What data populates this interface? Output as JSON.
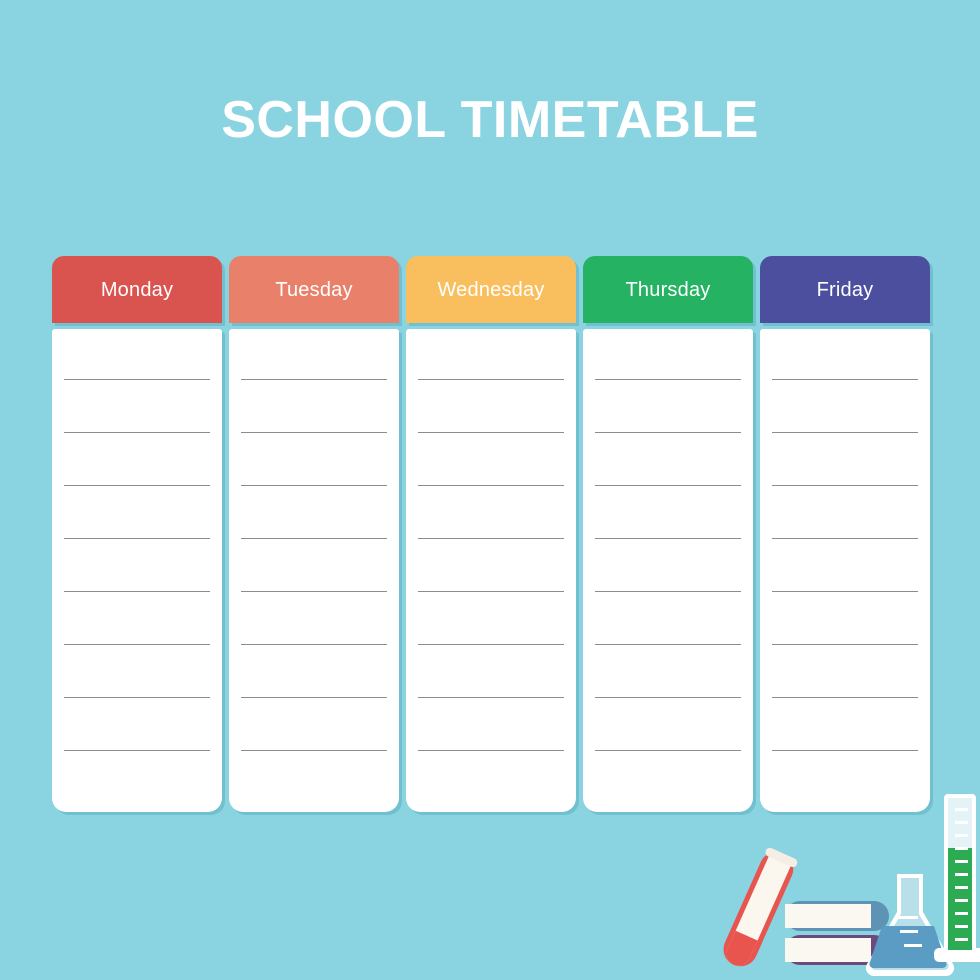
{
  "page": {
    "title": "SCHOOL TIMETABLE",
    "background_color": "#8ad3e0",
    "title_color": "#ffffff"
  },
  "timetable": {
    "line_color": "#8c8c8c",
    "card_color": "#ffffff",
    "lines_per_day": 8,
    "days": [
      {
        "label": "Monday",
        "color": "#d9534f"
      },
      {
        "label": "Tuesday",
        "color": "#e8806a"
      },
      {
        "label": "Wednesday",
        "color": "#f9bf5f"
      },
      {
        "label": "Thursday",
        "color": "#25b263"
      },
      {
        "label": "Friday",
        "color": "#4c4f9e"
      }
    ]
  },
  "decorations": {
    "items": [
      {
        "name": "test-tube",
        "color": "#e8544e"
      },
      {
        "name": "book-stack-top",
        "color": "#5f93b5"
      },
      {
        "name": "book-stack-bottom",
        "color": "#6d4a7e"
      },
      {
        "name": "erlenmeyer-flask",
        "color": "#5b9cc4"
      },
      {
        "name": "graduated-cylinder",
        "color": "#2bab52"
      }
    ]
  }
}
